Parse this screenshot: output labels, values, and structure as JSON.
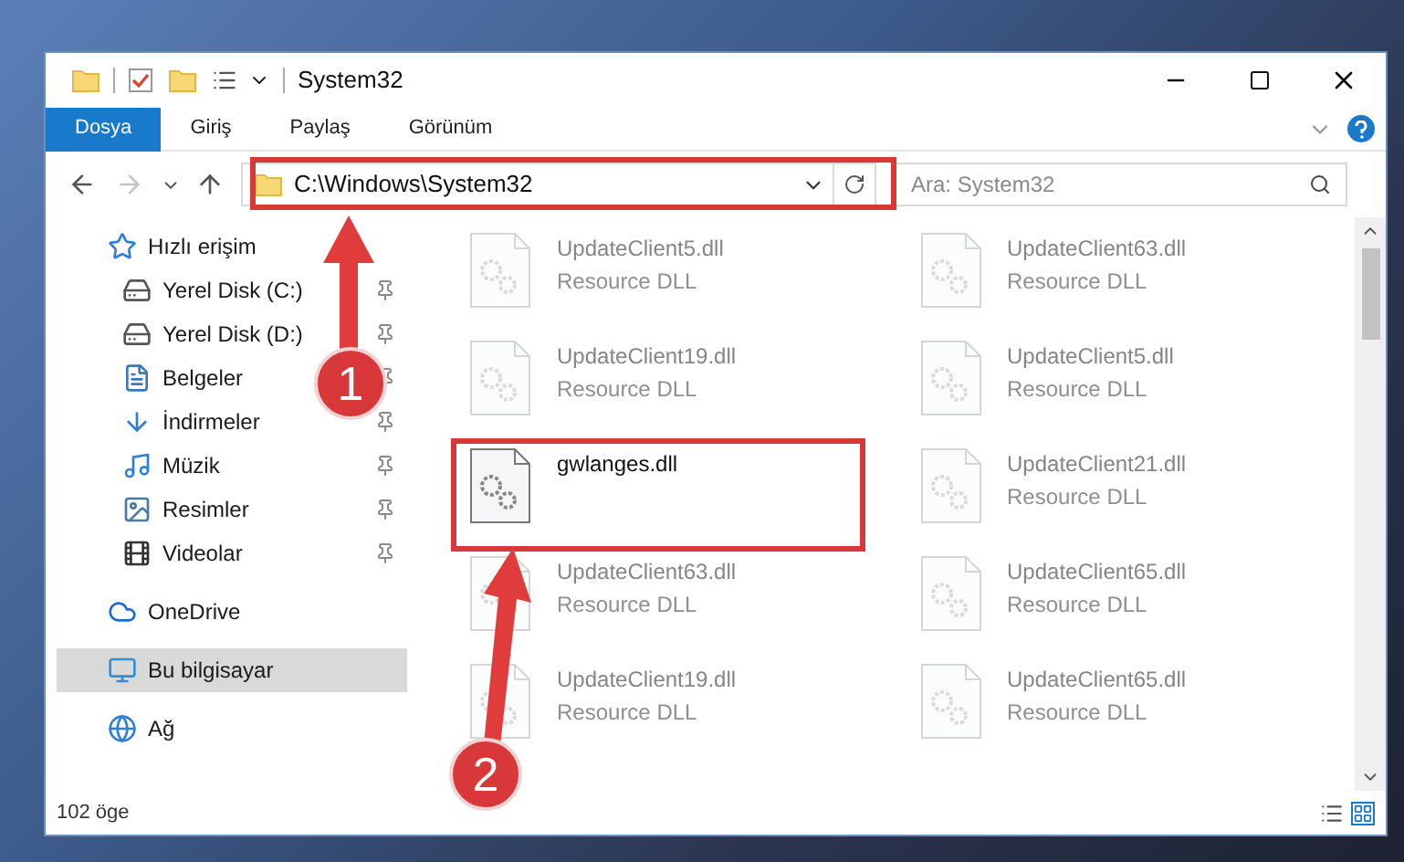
{
  "window": {
    "title": "System32"
  },
  "ribbon_tabs": [
    {
      "label": "Dosya",
      "selected": true
    },
    {
      "label": "Giriş",
      "selected": false
    },
    {
      "label": "Paylaş",
      "selected": false
    },
    {
      "label": "Görünüm",
      "selected": false
    }
  ],
  "address_bar": {
    "value": "C:\\Windows\\System32"
  },
  "search": {
    "placeholder": "Ara: System32"
  },
  "sidebar": {
    "items": [
      {
        "label": "Hızlı erişim",
        "kind": "star",
        "selected": false,
        "children": [
          {
            "label": "Yerel Disk (C:)",
            "kind": "drive",
            "selected": false,
            "pinned": true
          },
          {
            "label": "Yerel Disk (D:)",
            "kind": "drive",
            "selected": false,
            "pinned": true
          },
          {
            "label": "Belgeler",
            "kind": "document",
            "selected": false,
            "pinned": true
          },
          {
            "label": "İndirmeler",
            "kind": "download",
            "selected": false,
            "pinned": true
          },
          {
            "label": "Müzik",
            "kind": "music",
            "selected": false,
            "pinned": true
          },
          {
            "label": "Resimler",
            "kind": "pictures",
            "selected": false,
            "pinned": true
          },
          {
            "label": "Videolar",
            "kind": "video",
            "selected": false,
            "pinned": true
          }
        ]
      },
      {
        "label": "OneDrive",
        "kind": "cloud",
        "selected": false
      },
      {
        "label": "Bu bilgisayar",
        "kind": "computer",
        "selected": true
      },
      {
        "label": "Ağ",
        "kind": "network",
        "selected": false
      }
    ]
  },
  "files": [
    {
      "name": "UpdateClient5.dll",
      "type": "Resource DLL",
      "blurred": true
    },
    {
      "name": "UpdateClient63.dll",
      "type": "Resource DLL",
      "blurred": true
    },
    {
      "name": "UpdateClient19.dll",
      "type": "Resource DLL",
      "blurred": true
    },
    {
      "name": "UpdateClient5.dll",
      "type": "Resource DLL",
      "blurred": true
    },
    {
      "name": "gwlanges.dll",
      "blurred": false,
      "highlighted": true
    },
    {
      "name": "UpdateClient21.dll",
      "type": "Resource DLL",
      "blurred": true
    },
    {
      "name": "UpdateClient63.dll",
      "type": "Resource DLL",
      "blurred": true
    },
    {
      "name": "UpdateClient65.dll",
      "type": "Resource DLL",
      "blurred": true
    },
    {
      "name": "UpdateClient19.dll",
      "type": "Resource DLL",
      "blurred": true
    },
    {
      "name": "UpdateClient65.dll",
      "type": "Resource DLL",
      "blurred": true
    }
  ],
  "status_bar": {
    "item_count": "102 öge"
  },
  "annotations": [
    {
      "label": "1"
    },
    {
      "label": "2"
    }
  ]
}
